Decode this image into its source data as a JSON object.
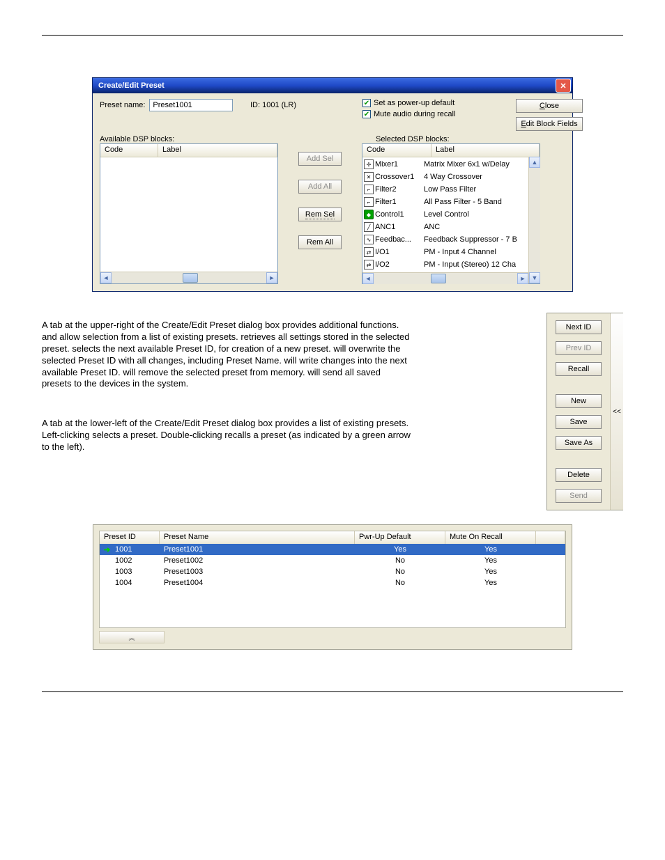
{
  "dialog": {
    "title": "Create/Edit Preset",
    "preset_name_label": "Preset name:",
    "preset_name_value": "Preset1001",
    "id_label": "ID: 1001 (LR)",
    "chk_powerup": "Set as power-up default",
    "chk_mute": "Mute audio during recall",
    "btn_close": "Close",
    "btn_edit_fields": "Edit Block Fields",
    "available_label": "Available DSP blocks:",
    "selected_label": "Selected DSP blocks:",
    "col_code": "Code",
    "col_label": "Label",
    "mid_buttons": {
      "add_sel": "Add Sel",
      "add_all": "Add All",
      "rem_sel": "Rem Sel",
      "rem_all": "Rem All"
    },
    "selected_blocks": [
      {
        "icon": "mixer-icon",
        "glyph": "✢",
        "code": "Mixer1",
        "label": "Matrix Mixer  6x1 w/Delay"
      },
      {
        "icon": "crossover-icon",
        "glyph": "✕",
        "code": "Crossover1",
        "label": "4 Way  Crossover"
      },
      {
        "icon": "filter-icon",
        "glyph": "⌐",
        "code": "Filter2",
        "label": "Low Pass Filter"
      },
      {
        "icon": "filter-icon",
        "glyph": "⌐",
        "code": "Filter1",
        "label": "All Pass Filter - 5 Band"
      },
      {
        "icon": "control-icon",
        "glyph": "◆",
        "green": true,
        "code": "Control1",
        "label": "Level Control"
      },
      {
        "icon": "anc-icon",
        "glyph": "╱",
        "code": "ANC1",
        "label": "ANC"
      },
      {
        "icon": "feedback-icon",
        "glyph": "∿",
        "code": "Feedbac...",
        "label": "Feedback Suppressor - 7 B"
      },
      {
        "icon": "io-icon",
        "glyph": "⇄",
        "code": "I/O1",
        "label": "PM - Input  4 Channel"
      },
      {
        "icon": "io-icon",
        "glyph": "⇄",
        "code": "I/O2",
        "label": "PM -  Input (Stereo)  12 Cha"
      }
    ]
  },
  "paragraph1": "A tab at the upper-right of the Create/Edit Preset dialog box provides additional functions.            and             allow selection from a list of existing presets.           retrieves all settings stored in the selected preset.          selects the next available Preset ID, for creation of a new preset.          will overwrite the selected Preset ID with all changes, including Preset Name.                 will write changes into the next available Preset ID.              will remove the selected preset from memory.          will send all saved presets to the devices in the system.",
  "paragraph2": "A tab at the lower-left of the Create/Edit Preset dialog box provides a list of existing presets. Left-clicking selects a preset. Double-clicking recalls a preset (as indicated by a green arrow to the left).",
  "side_panel": {
    "buttons": [
      "Next ID",
      "Prev ID",
      "Recall",
      "New",
      "Save",
      "Save As",
      "Delete",
      "Send"
    ],
    "collapse": "<<"
  },
  "preset_table": {
    "headers": {
      "id": "Preset ID",
      "name": "Preset Name",
      "pwr": "Pwr-Up Default",
      "mute": "Mute On Recall"
    },
    "rows": [
      {
        "arrow": true,
        "id": "1001",
        "name": "Preset1001",
        "pwr": "Yes",
        "mute": "Yes",
        "selected": true
      },
      {
        "arrow": false,
        "id": "1002",
        "name": "Preset1002",
        "pwr": "No",
        "mute": "Yes",
        "selected": false
      },
      {
        "arrow": false,
        "id": "1003",
        "name": "Preset1003",
        "pwr": "No",
        "mute": "Yes",
        "selected": false
      },
      {
        "arrow": false,
        "id": "1004",
        "name": "Preset1004",
        "pwr": "No",
        "mute": "Yes",
        "selected": false
      }
    ],
    "tab_glyph": "︽"
  }
}
